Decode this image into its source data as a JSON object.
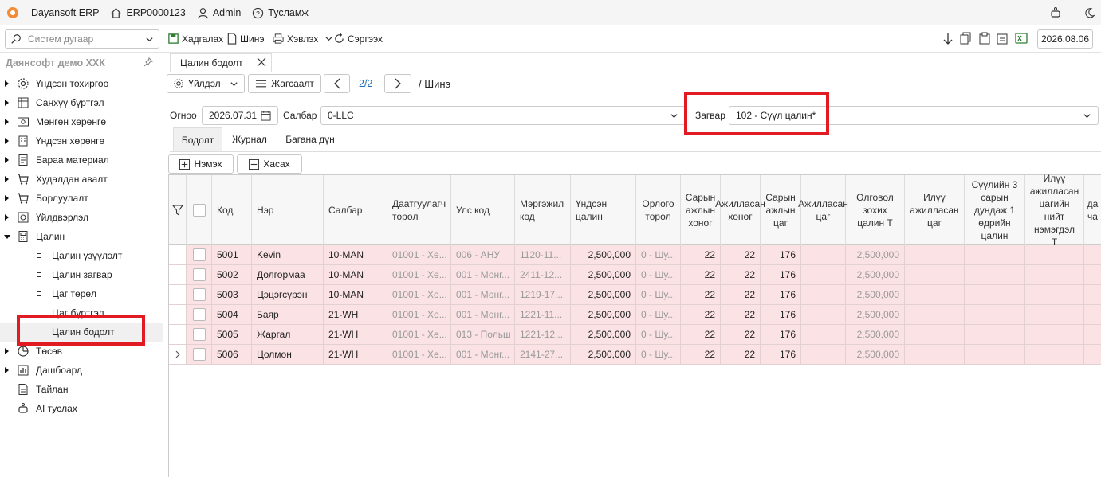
{
  "app": {
    "name": "Dayansoft ERP",
    "doc_no": "ERP0000123",
    "user": "Admin",
    "help": "Тусламж"
  },
  "toolbar": {
    "search_placeholder": "Систем дугаар",
    "save": "Хадгалах",
    "new": "Шинэ",
    "print": "Хэвлэх",
    "refresh": "Сэргээх",
    "date": "2026.08.06"
  },
  "sidebar": {
    "company": "Даянсофт демо ХХК",
    "items": [
      {
        "label": "Үндсэн тохиргоо",
        "icon": "gear-icon"
      },
      {
        "label": "Санхүү бүртгэл",
        "icon": "ledger-icon"
      },
      {
        "label": "Мөнгөн хөрөнгө",
        "icon": "cash-icon"
      },
      {
        "label": "Үндсэн хөрөнгө",
        "icon": "building-icon"
      },
      {
        "label": "Бараа материал",
        "icon": "box-icon"
      },
      {
        "label": "Худалдан авалт",
        "icon": "cart-icon"
      },
      {
        "label": "Борлуулалт",
        "icon": "cart-icon"
      },
      {
        "label": "Үйлдвэрлэл",
        "icon": "factory-icon"
      },
      {
        "label": "Цалин",
        "icon": "calculator-icon"
      }
    ],
    "sub_items": [
      "Цалин үзүүлэлт",
      "Цалин загвар",
      "Цаг төрөл",
      "Цаг бүртгэл",
      "Цалин бодолт"
    ],
    "after": [
      {
        "label": "Төсөв",
        "icon": "pie-icon"
      },
      {
        "label": "Дашбоард",
        "icon": "dashboard-icon"
      },
      {
        "label": "Тайлан",
        "icon": "report-icon"
      },
      {
        "label": "AI туслах",
        "icon": "robot-icon"
      }
    ]
  },
  "doc": {
    "tab": "Цалин бодолт",
    "actions": "Үйлдэл",
    "list": "Жагсаалт",
    "pager": "2/2",
    "crumb": "/ Шинэ",
    "date_label": "Огноо",
    "date": "2026.07.31",
    "branch_label": "Салбар",
    "branch": "0-LLC",
    "template_label": "Загвар",
    "template": "102 - Сүүл цалин*"
  },
  "subtabs": [
    "Бодолт",
    "Журнал",
    "Багана дүн"
  ],
  "grid": {
    "add": "Нэмэх",
    "remove": "Хасах",
    "headers": [
      "Код",
      "Нэр",
      "Салбар",
      "Даатгуулагч төрөл",
      "Улс код",
      "Мэргэжил код",
      "Үндсэн цалин",
      "Орлого төрөл",
      "Сарын ажлын хоног",
      "Ажилласан хоног",
      "Сарын ажлын цаг",
      "Ажилласан цаг",
      "Олговол зохих цалин Т",
      "Илүү ажилласан цаг",
      "Сүүлийн 3 сарын дундаж 1 өдрийн цалин",
      "Илүү ажилласан цагийн нийт нэмэгдэл Т",
      "да ча"
    ],
    "rows": [
      [
        "5001",
        "Kevin",
        "10-MAN",
        "01001 - Хө...",
        "006 - АНУ",
        "1120-11...",
        "2,500,000",
        "0 - Шу...",
        "22",
        "22",
        "176",
        "",
        "2,500,000"
      ],
      [
        "5002",
        "Долгормаа",
        "10-MAN",
        "01001 - Хө...",
        "001 - Монг...",
        "2411-12...",
        "2,500,000",
        "0 - Шу...",
        "22",
        "22",
        "176",
        "",
        "2,500,000"
      ],
      [
        "5003",
        "Цэцэгсүрэн",
        "10-MAN",
        "01001 - Хө...",
        "001 - Монг...",
        "1219-17...",
        "2,500,000",
        "0 - Шу...",
        "22",
        "22",
        "176",
        "",
        "2,500,000"
      ],
      [
        "5004",
        "Баяр",
        "21-WH",
        "01001 - Хө...",
        "001 - Монг...",
        "1221-11...",
        "2,500,000",
        "0 - Шу...",
        "22",
        "22",
        "176",
        "",
        "2,500,000"
      ],
      [
        "5005",
        "Жаргал",
        "21-WH",
        "01001 - Хө...",
        "013 - Польш",
        "1221-12...",
        "2,500,000",
        "0 - Шу...",
        "22",
        "22",
        "176",
        "",
        "2,500,000"
      ],
      [
        "5006",
        "Цолмон",
        "21-WH",
        "01001 - Хө...",
        "001 - Монг...",
        "2141-27...",
        "2,500,000",
        "0 - Шу...",
        "22",
        "22",
        "176",
        "",
        "2,500,000"
      ]
    ]
  }
}
